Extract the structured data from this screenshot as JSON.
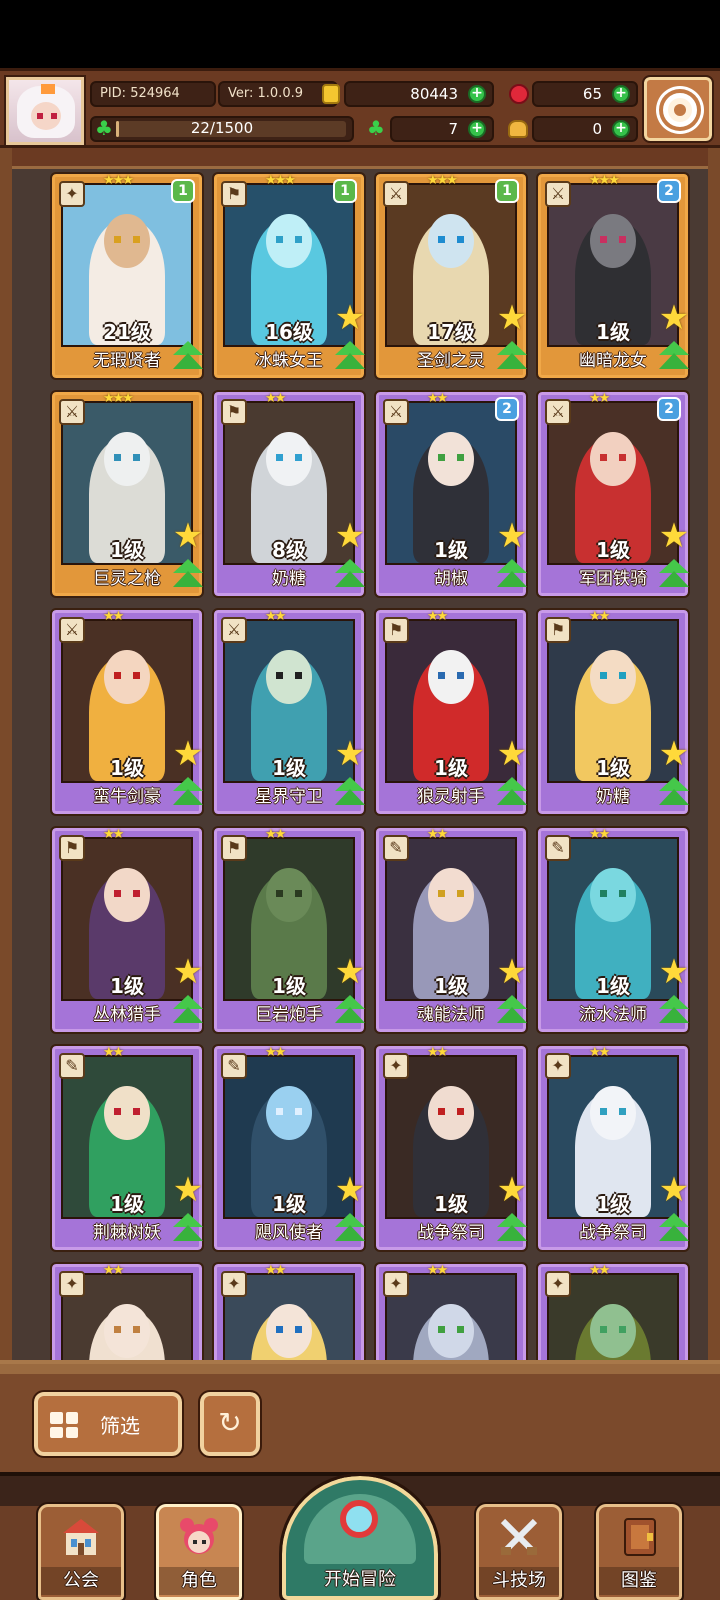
{
  "header": {
    "pid_label": "PID: 524964",
    "version_label": "Ver: 1.0.0.9",
    "gold": "80443",
    "ruby": "65",
    "exp": "22/1500",
    "exp_fraction": 0.0147,
    "clover": "7",
    "bread": "0",
    "icons": [
      "avatar",
      "coin-icon",
      "ruby-icon",
      "clover-icon",
      "bread-icon",
      "gear-icon"
    ]
  },
  "heroes": [
    {
      "name": "无瑕贤者",
      "level": "21级",
      "stars": "★★★",
      "badge": "1",
      "frame": "orange",
      "class_icon": "✦",
      "colors": [
        "#7fbfe0",
        "#f4ece4",
        "#e0b890",
        "#d9a020"
      ]
    },
    {
      "name": "冰蛛女王",
      "level": "16级",
      "stars": "★★★",
      "badge": "1",
      "frame": "orange",
      "class_icon": "⚑",
      "colors": [
        "#26506a",
        "#59c8e0",
        "#bfeff7",
        "#2ea0c8"
      ]
    },
    {
      "name": "圣剑之灵",
      "level": "17级",
      "stars": "★★★",
      "badge": "1",
      "frame": "orange",
      "class_icon": "⚔",
      "colors": [
        "#5a3a22",
        "#e8d8b0",
        "#cfe4f0",
        "#1e8cd0"
      ]
    },
    {
      "name": "幽暗龙女",
      "level": "1级",
      "stars": "★★★",
      "badge": "2",
      "frame": "orange",
      "class_icon": "⚔",
      "colors": [
        "#4a3a44",
        "#2f2f33",
        "#7a7a80",
        "#c83060"
      ]
    },
    {
      "name": "巨灵之枪",
      "level": "1级",
      "stars": "★★★",
      "badge": "",
      "frame": "orange",
      "class_icon": "⚔",
      "colors": [
        "#3a5a68",
        "#dcdcd6",
        "#eef0f0",
        "#3090b8"
      ]
    },
    {
      "name": "奶糖",
      "level": "8级",
      "stars": "★★",
      "badge": "",
      "frame": "purple",
      "class_icon": "⚑",
      "colors": [
        "#4a3a30",
        "#d0d4d8",
        "#f0f2f4",
        "#30a0d0"
      ]
    },
    {
      "name": "胡椒",
      "level": "1级",
      "stars": "★★",
      "badge": "2",
      "frame": "purple",
      "class_icon": "⚔",
      "colors": [
        "#2a4a66",
        "#2f3038",
        "#f2e2d8",
        "#40a040"
      ]
    },
    {
      "name": "军团铁骑",
      "level": "1级",
      "stars": "★★",
      "badge": "2",
      "frame": "purple",
      "class_icon": "⚔",
      "colors": [
        "#4a3026",
        "#c83030",
        "#f2d0c0",
        "#c83030"
      ]
    },
    {
      "name": "蛮牛剑豪",
      "level": "1级",
      "stars": "★★",
      "badge": "",
      "frame": "purple",
      "class_icon": "⚔",
      "colors": [
        "#4a3024",
        "#f0b040",
        "#f4d6c0",
        "#c02020"
      ]
    },
    {
      "name": "星界守卫",
      "level": "1级",
      "stars": "★★",
      "badge": "",
      "frame": "purple",
      "class_icon": "⚔",
      "colors": [
        "#2a4a60",
        "#40a0b0",
        "#d0e4d0",
        "#202020"
      ]
    },
    {
      "name": "狼灵射手",
      "level": "1级",
      "stars": "★★",
      "badge": "",
      "frame": "purple",
      "class_icon": "⚑",
      "colors": [
        "#3a2a3a",
        "#d02a2a",
        "#f2f2f2",
        "#2a6ab0"
      ]
    },
    {
      "name": "奶糖",
      "level": "1级",
      "stars": "★★",
      "badge": "",
      "frame": "purple",
      "class_icon": "⚑",
      "colors": [
        "#2f3a4a",
        "#f2c860",
        "#f4dcc4",
        "#20a0c0"
      ]
    },
    {
      "name": "丛林猎手",
      "level": "1级",
      "stars": "★★",
      "badge": "",
      "frame": "purple",
      "class_icon": "⚑",
      "colors": [
        "#4a3024",
        "#5a3a6a",
        "#f2d8c8",
        "#c02030"
      ]
    },
    {
      "name": "巨岩炮手",
      "level": "1级",
      "stars": "★★",
      "badge": "",
      "frame": "purple",
      "class_icon": "⚑",
      "colors": [
        "#2f3a2a",
        "#5a7a4a",
        "#6a8a58",
        "#2a3a20"
      ]
    },
    {
      "name": "魂能法师",
      "level": "1级",
      "stars": "★★",
      "badge": "",
      "frame": "purple",
      "class_icon": "✎",
      "colors": [
        "#3a3040",
        "#9898b8",
        "#f2dcd0",
        "#d0a020"
      ]
    },
    {
      "name": "流水法师",
      "level": "1级",
      "stars": "★★",
      "badge": "",
      "frame": "purple",
      "class_icon": "✎",
      "colors": [
        "#2a4a5a",
        "#40b0c0",
        "#7ad8e0",
        "#208060"
      ]
    },
    {
      "name": "荆棘树妖",
      "level": "1级",
      "stars": "★★",
      "badge": "",
      "frame": "purple",
      "class_icon": "✎",
      "colors": [
        "#2f4a3a",
        "#30a060",
        "#f0e0c8",
        "#c02030"
      ]
    },
    {
      "name": "飓风使者",
      "level": "1级",
      "stars": "★★",
      "badge": "",
      "frame": "purple",
      "class_icon": "✎",
      "colors": [
        "#1f3a50",
        "#30506a",
        "#9ad0f0",
        "#e0f0ff"
      ]
    },
    {
      "name": "战争祭司",
      "level": "1级",
      "stars": "★★",
      "badge": "",
      "frame": "purple",
      "class_icon": "✦",
      "colors": [
        "#3a2a24",
        "#303038",
        "#f0dcd0",
        "#c02020"
      ]
    },
    {
      "name": "战争祭司",
      "level": "1级",
      "stars": "★★",
      "badge": "",
      "frame": "purple",
      "class_icon": "✦",
      "colors": [
        "#2a4a60",
        "#e0e6f0",
        "#f2f4f8",
        "#30a0c0"
      ]
    },
    {
      "name": "",
      "level": "",
      "stars": "★★",
      "badge": "",
      "frame": "purple",
      "class_icon": "✦",
      "colors": [
        "#4a3a30",
        "#f0e0d0",
        "#f4e4d8",
        "#c08040"
      ]
    },
    {
      "name": "",
      "level": "",
      "stars": "★★",
      "badge": "",
      "frame": "purple",
      "class_icon": "✦",
      "colors": [
        "#3a4a5a",
        "#f0d070",
        "#f4e4d8",
        "#2070c0"
      ]
    },
    {
      "name": "",
      "level": "",
      "stars": "★★",
      "badge": "",
      "frame": "purple",
      "class_icon": "✦",
      "colors": [
        "#3a3a4a",
        "#a0a8c0",
        "#d0d8e8",
        "#40a040"
      ]
    },
    {
      "name": "",
      "level": "",
      "stars": "★★",
      "badge": "",
      "frame": "purple",
      "class_icon": "✦",
      "colors": [
        "#3a3a2a",
        "#6a7a30",
        "#90c090",
        "#40a060"
      ]
    }
  ],
  "controls": {
    "filter_label": "筛选",
    "refresh_icon": "refresh-icon"
  },
  "nav": {
    "guild": "公会",
    "heroes": "角色",
    "adventure": "开始冒险",
    "arena": "斗技场",
    "codex": "图鉴"
  }
}
